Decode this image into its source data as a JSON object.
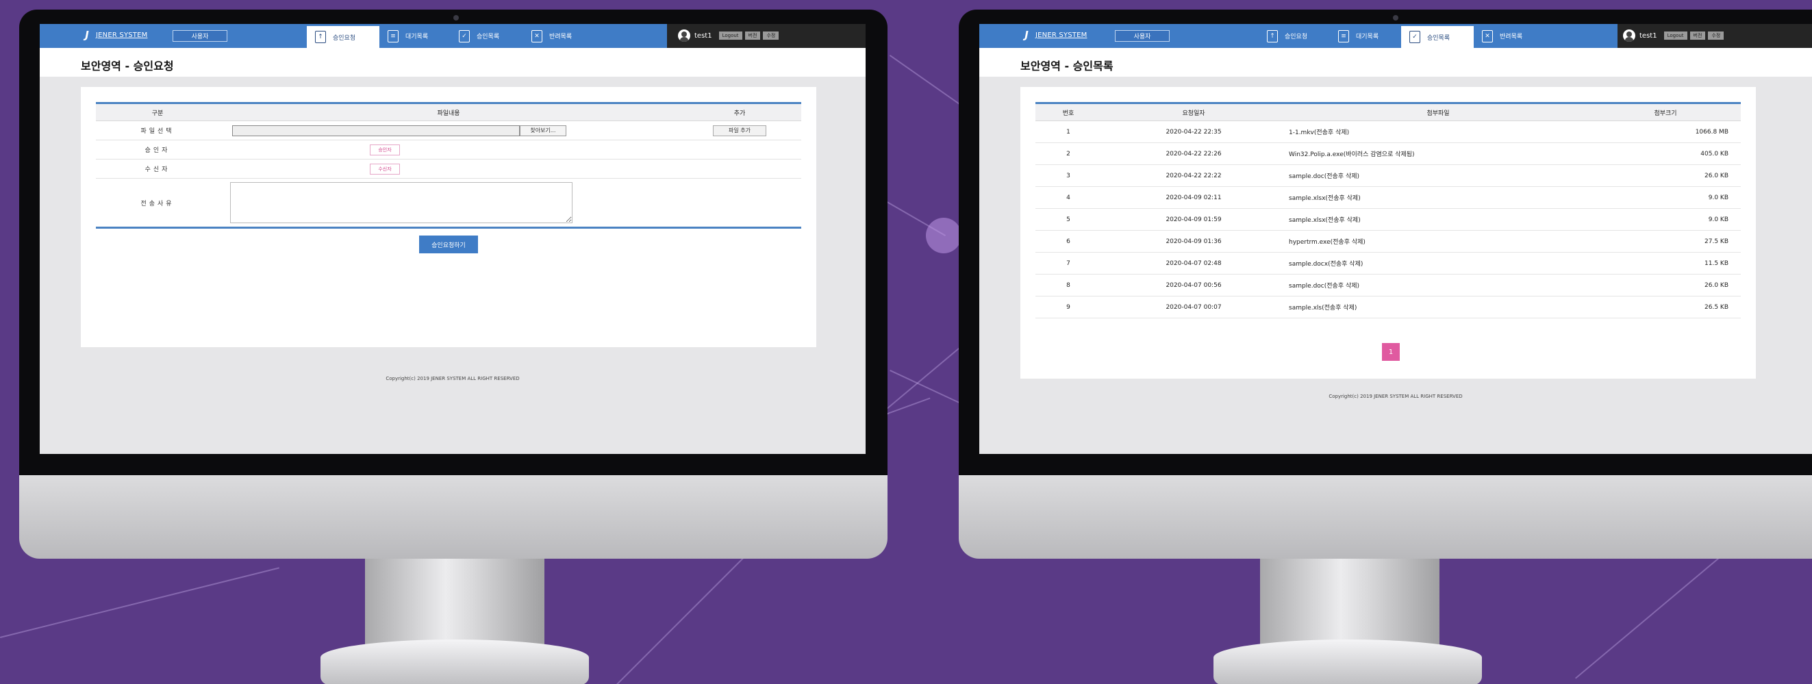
{
  "brand": {
    "logo_text": "JENER SYSTEM",
    "logo_mark": "J"
  },
  "common": {
    "role_button": "사용자",
    "user_name": "test1",
    "logout": "Logout",
    "btn_version": "버전",
    "btn_edit": "수정",
    "copyright": "Copyright(c) 2019 JENER SYSTEM ALL RIGHT RESERVED"
  },
  "tabs": [
    {
      "label": "승인요청",
      "icon": "approval-request-icon"
    },
    {
      "label": "대기목록",
      "icon": "pending-list-icon"
    },
    {
      "label": "승인목록",
      "icon": "approved-list-icon"
    },
    {
      "label": "반려목록",
      "icon": "rejected-list-icon"
    }
  ],
  "left_screen": {
    "page_title": "보안영역 - 승인요청",
    "active_tab": 0,
    "table_headers": {
      "category": "구분",
      "content": "파일내용",
      "add": "추가"
    },
    "rows": {
      "file_select": "파일선택",
      "approver": "승인자",
      "recipient": "수신자",
      "reason": "전송사유"
    },
    "browse_button": "찾아보기...",
    "add_file_button": "파일 추가",
    "approver_button": "승인자",
    "recipient_button": "수신자",
    "submit_button": "승인요청하기"
  },
  "right_screen": {
    "page_title": "보안영역 - 승인목록",
    "active_tab": 2,
    "columns": [
      "번호",
      "요청일자",
      "첨부파일",
      "첨부크기"
    ],
    "rows": [
      {
        "no": "1",
        "date": "2020-04-22 22:35",
        "file": "1-1.mkv(전송후 삭제)",
        "size": "1066.8 MB"
      },
      {
        "no": "2",
        "date": "2020-04-22 22:26",
        "file": "Win32.Polip.a.exe(바이러스 감염으로 삭제됨)",
        "size": "405.0 KB"
      },
      {
        "no": "3",
        "date": "2020-04-22 22:22",
        "file": "sample.doc(전송후 삭제)",
        "size": "26.0 KB"
      },
      {
        "no": "4",
        "date": "2020-04-09 02:11",
        "file": "sample.xlsx(전송후 삭제)",
        "size": "9.0 KB"
      },
      {
        "no": "5",
        "date": "2020-04-09 01:59",
        "file": "sample.xlsx(전송후 삭제)",
        "size": "9.0 KB"
      },
      {
        "no": "6",
        "date": "2020-04-09 01:36",
        "file": "hypertrm.exe(전송후 삭제)",
        "size": "27.5 KB"
      },
      {
        "no": "7",
        "date": "2020-04-07 02:48",
        "file": "sample.docx(전송후 삭제)",
        "size": "11.5 KB"
      },
      {
        "no": "8",
        "date": "2020-04-07 00:56",
        "file": "sample.doc(전송후 삭제)",
        "size": "26.0 KB"
      },
      {
        "no": "9",
        "date": "2020-04-07 00:07",
        "file": "sample.xls(전송후 삭제)",
        "size": "26.5 KB"
      }
    ],
    "current_page": "1"
  },
  "colors": {
    "nav_blue": "#3f7cc6",
    "nav_dark": "#252525",
    "accent_pink": "#e05aa0",
    "background_purple": "#5a3a86"
  }
}
